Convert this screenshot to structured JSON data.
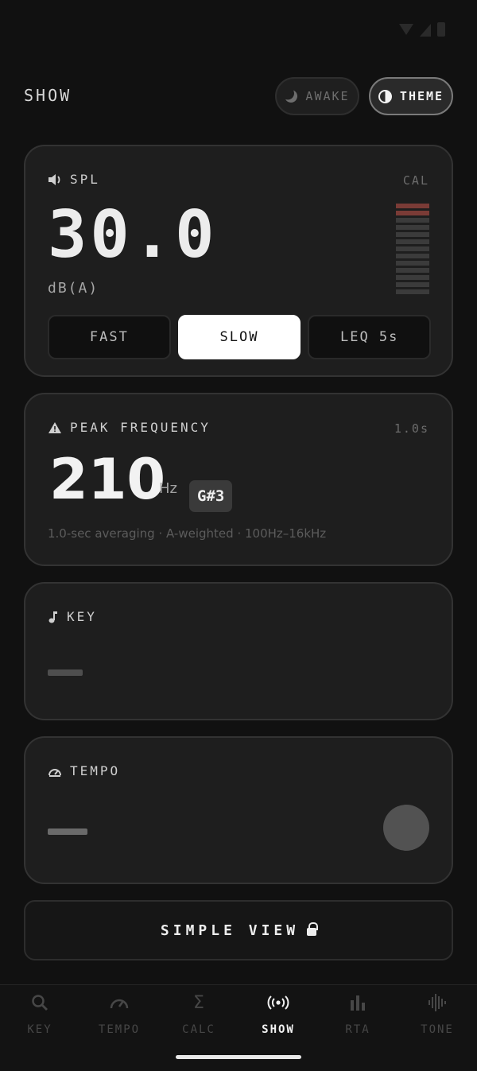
{
  "header": {
    "title": "SHOW",
    "awake_label": "AWAKE",
    "theme_label": "THEME"
  },
  "spl": {
    "label": "SPL",
    "meta": "CAL",
    "value": "30.0",
    "unit": "dB(A)",
    "meter_segments_total": 13,
    "meter_segments_hot": 2,
    "hot_color": "#7a3b36",
    "modes": [
      {
        "label": "FAST"
      },
      {
        "label": "SLOW"
      },
      {
        "label": "LEQ 5s"
      }
    ],
    "selected_mode": "SLOW"
  },
  "peak": {
    "label": "PEAK FREQUENCY",
    "meta": "1.0s",
    "value": "210",
    "unit": "Hz",
    "note": "G#3",
    "description": "1.0-sec averaging · A-weighted · 100Hz–16kHz"
  },
  "key": {
    "label": "KEY"
  },
  "tempo": {
    "label": "TEMPO"
  },
  "simple_view": {
    "label": "SIMPLE VIEW"
  },
  "nav": {
    "items": [
      {
        "label": "KEY",
        "icon": "search-icon"
      },
      {
        "label": "TEMPO",
        "icon": "speedometer-icon"
      },
      {
        "label": "CALC",
        "icon": "sigma-icon"
      },
      {
        "label": "SHOW",
        "icon": "broadcast-icon"
      },
      {
        "label": "RTA",
        "icon": "bar-chart-icon"
      },
      {
        "label": "TONE",
        "icon": "waveform-icon"
      }
    ],
    "active": "SHOW"
  }
}
